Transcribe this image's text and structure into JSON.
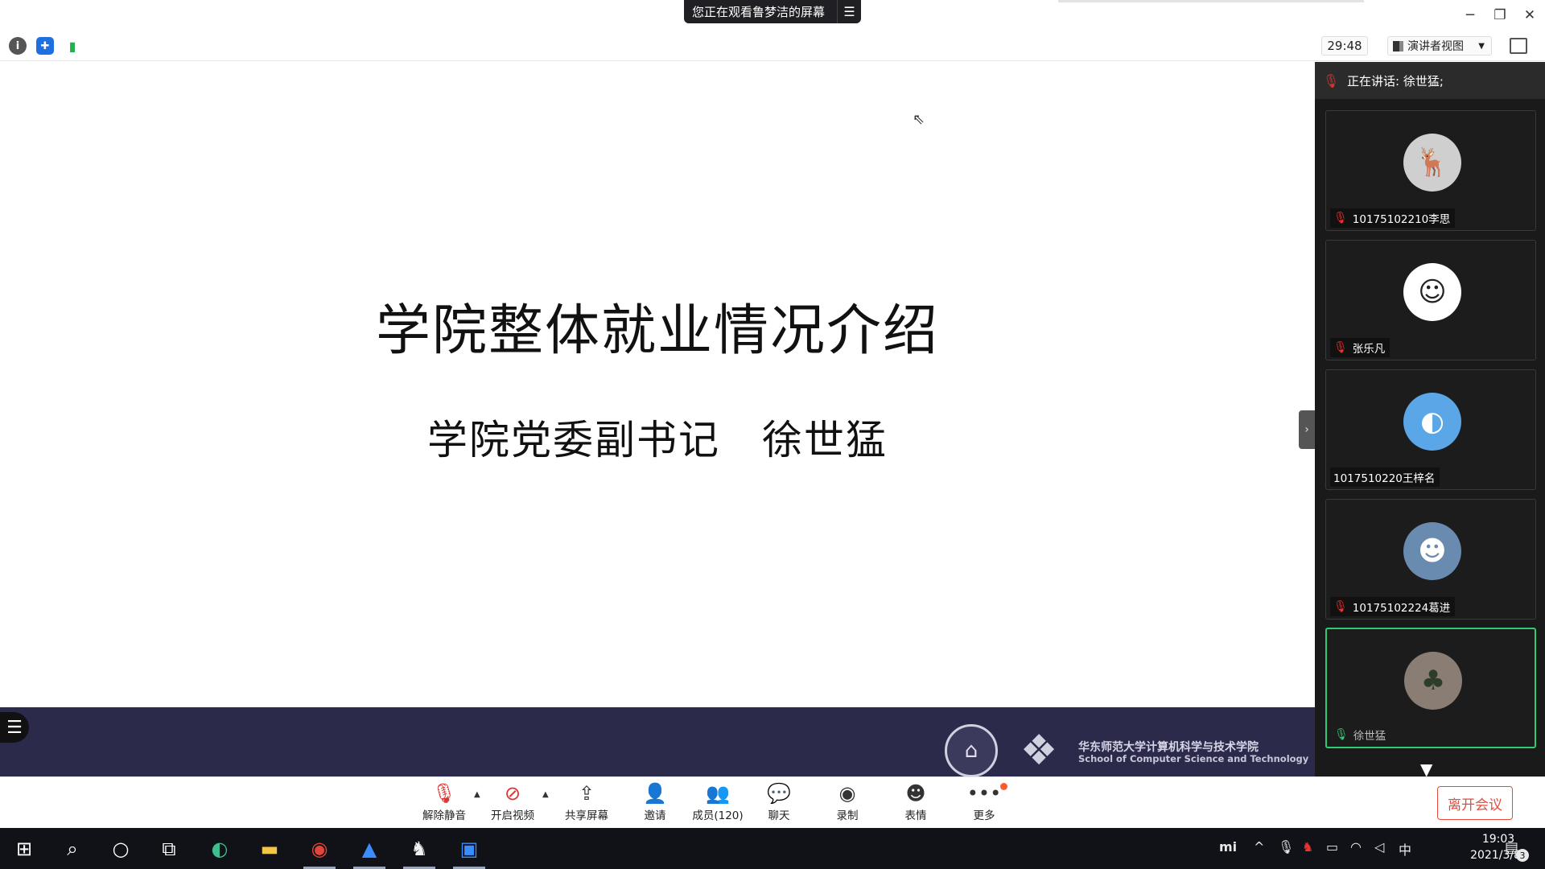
{
  "title_bar": {
    "share_banner": "您正在观看鲁梦洁的屏幕",
    "menu_icon": "list-icon",
    "minimize": "─",
    "restore": "❐",
    "close": "✕"
  },
  "toolbar": {
    "info_icon": "i",
    "shield_icon": "✚",
    "signal_icon": "▮",
    "timer": "29:48",
    "presenter_view_label": "演讲者视图"
  },
  "slide": {
    "title": "学院整体就业情况介绍",
    "subtitle": "学院党委副书记　徐世猛",
    "footer_cn": "华东师范大学计算机科学与技术学院",
    "footer_en": "School of Computer Science and Technology"
  },
  "panel": {
    "speaking_label": "正在讲话: 徐世猛;",
    "participants": [
      {
        "name": "10175102210李思",
        "muted": true,
        "avatar": "deer-avatar"
      },
      {
        "name": "张乐凡",
        "muted": true,
        "avatar": "cartoon-avatar"
      },
      {
        "name": "1017510220王梓名",
        "muted": false,
        "avatar": "glass-avatar"
      },
      {
        "name": "10175102224葛进",
        "muted": true,
        "avatar": "baby-avatar"
      },
      {
        "name": "徐世猛",
        "muted": false,
        "avatar": "bonsai-avatar"
      }
    ]
  },
  "controls": {
    "unmute": "解除静音",
    "start_video": "开启视频",
    "share_screen": "共享屏幕",
    "invite": "邀请",
    "members": "成员(120)",
    "chat": "聊天",
    "record": "录制",
    "reactions": "表情",
    "more": "更多",
    "leave": "离开会议"
  },
  "taskbar": {
    "ime": "中",
    "time": "19:03",
    "date": "2021/3/8",
    "notifications": "3"
  },
  "colors": {
    "footer_bg": "#2c2a4a",
    "panel_bg": "#1a1a1a",
    "leave_red": "#e54b3c",
    "active_green": "#2ecc71"
  }
}
